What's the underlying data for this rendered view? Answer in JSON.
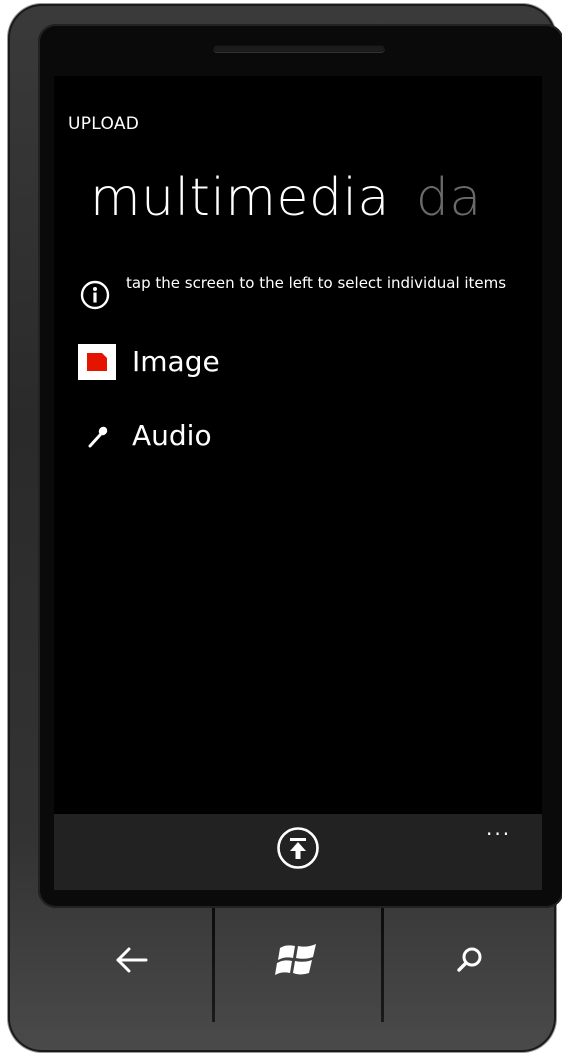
{
  "app": {
    "title": "UPLOAD"
  },
  "pivot": {
    "active": "multimedia",
    "next_peek": "da"
  },
  "info": {
    "text": "tap the screen to the left to select individual items",
    "icon": "info-icon"
  },
  "items": [
    {
      "label": "Image",
      "icon": "image-icon"
    },
    {
      "label": "Audio",
      "icon": "microphone-icon"
    }
  ],
  "appbar": {
    "button_icon": "upload-icon",
    "more": "..."
  },
  "hardware": {
    "back": "back-arrow-icon",
    "start": "windows-logo-icon",
    "search": "search-icon"
  },
  "colors": {
    "accent": "#e51400",
    "background": "#000000",
    "appbar": "#222222",
    "inactive_pivot": "#6a6a6a"
  }
}
